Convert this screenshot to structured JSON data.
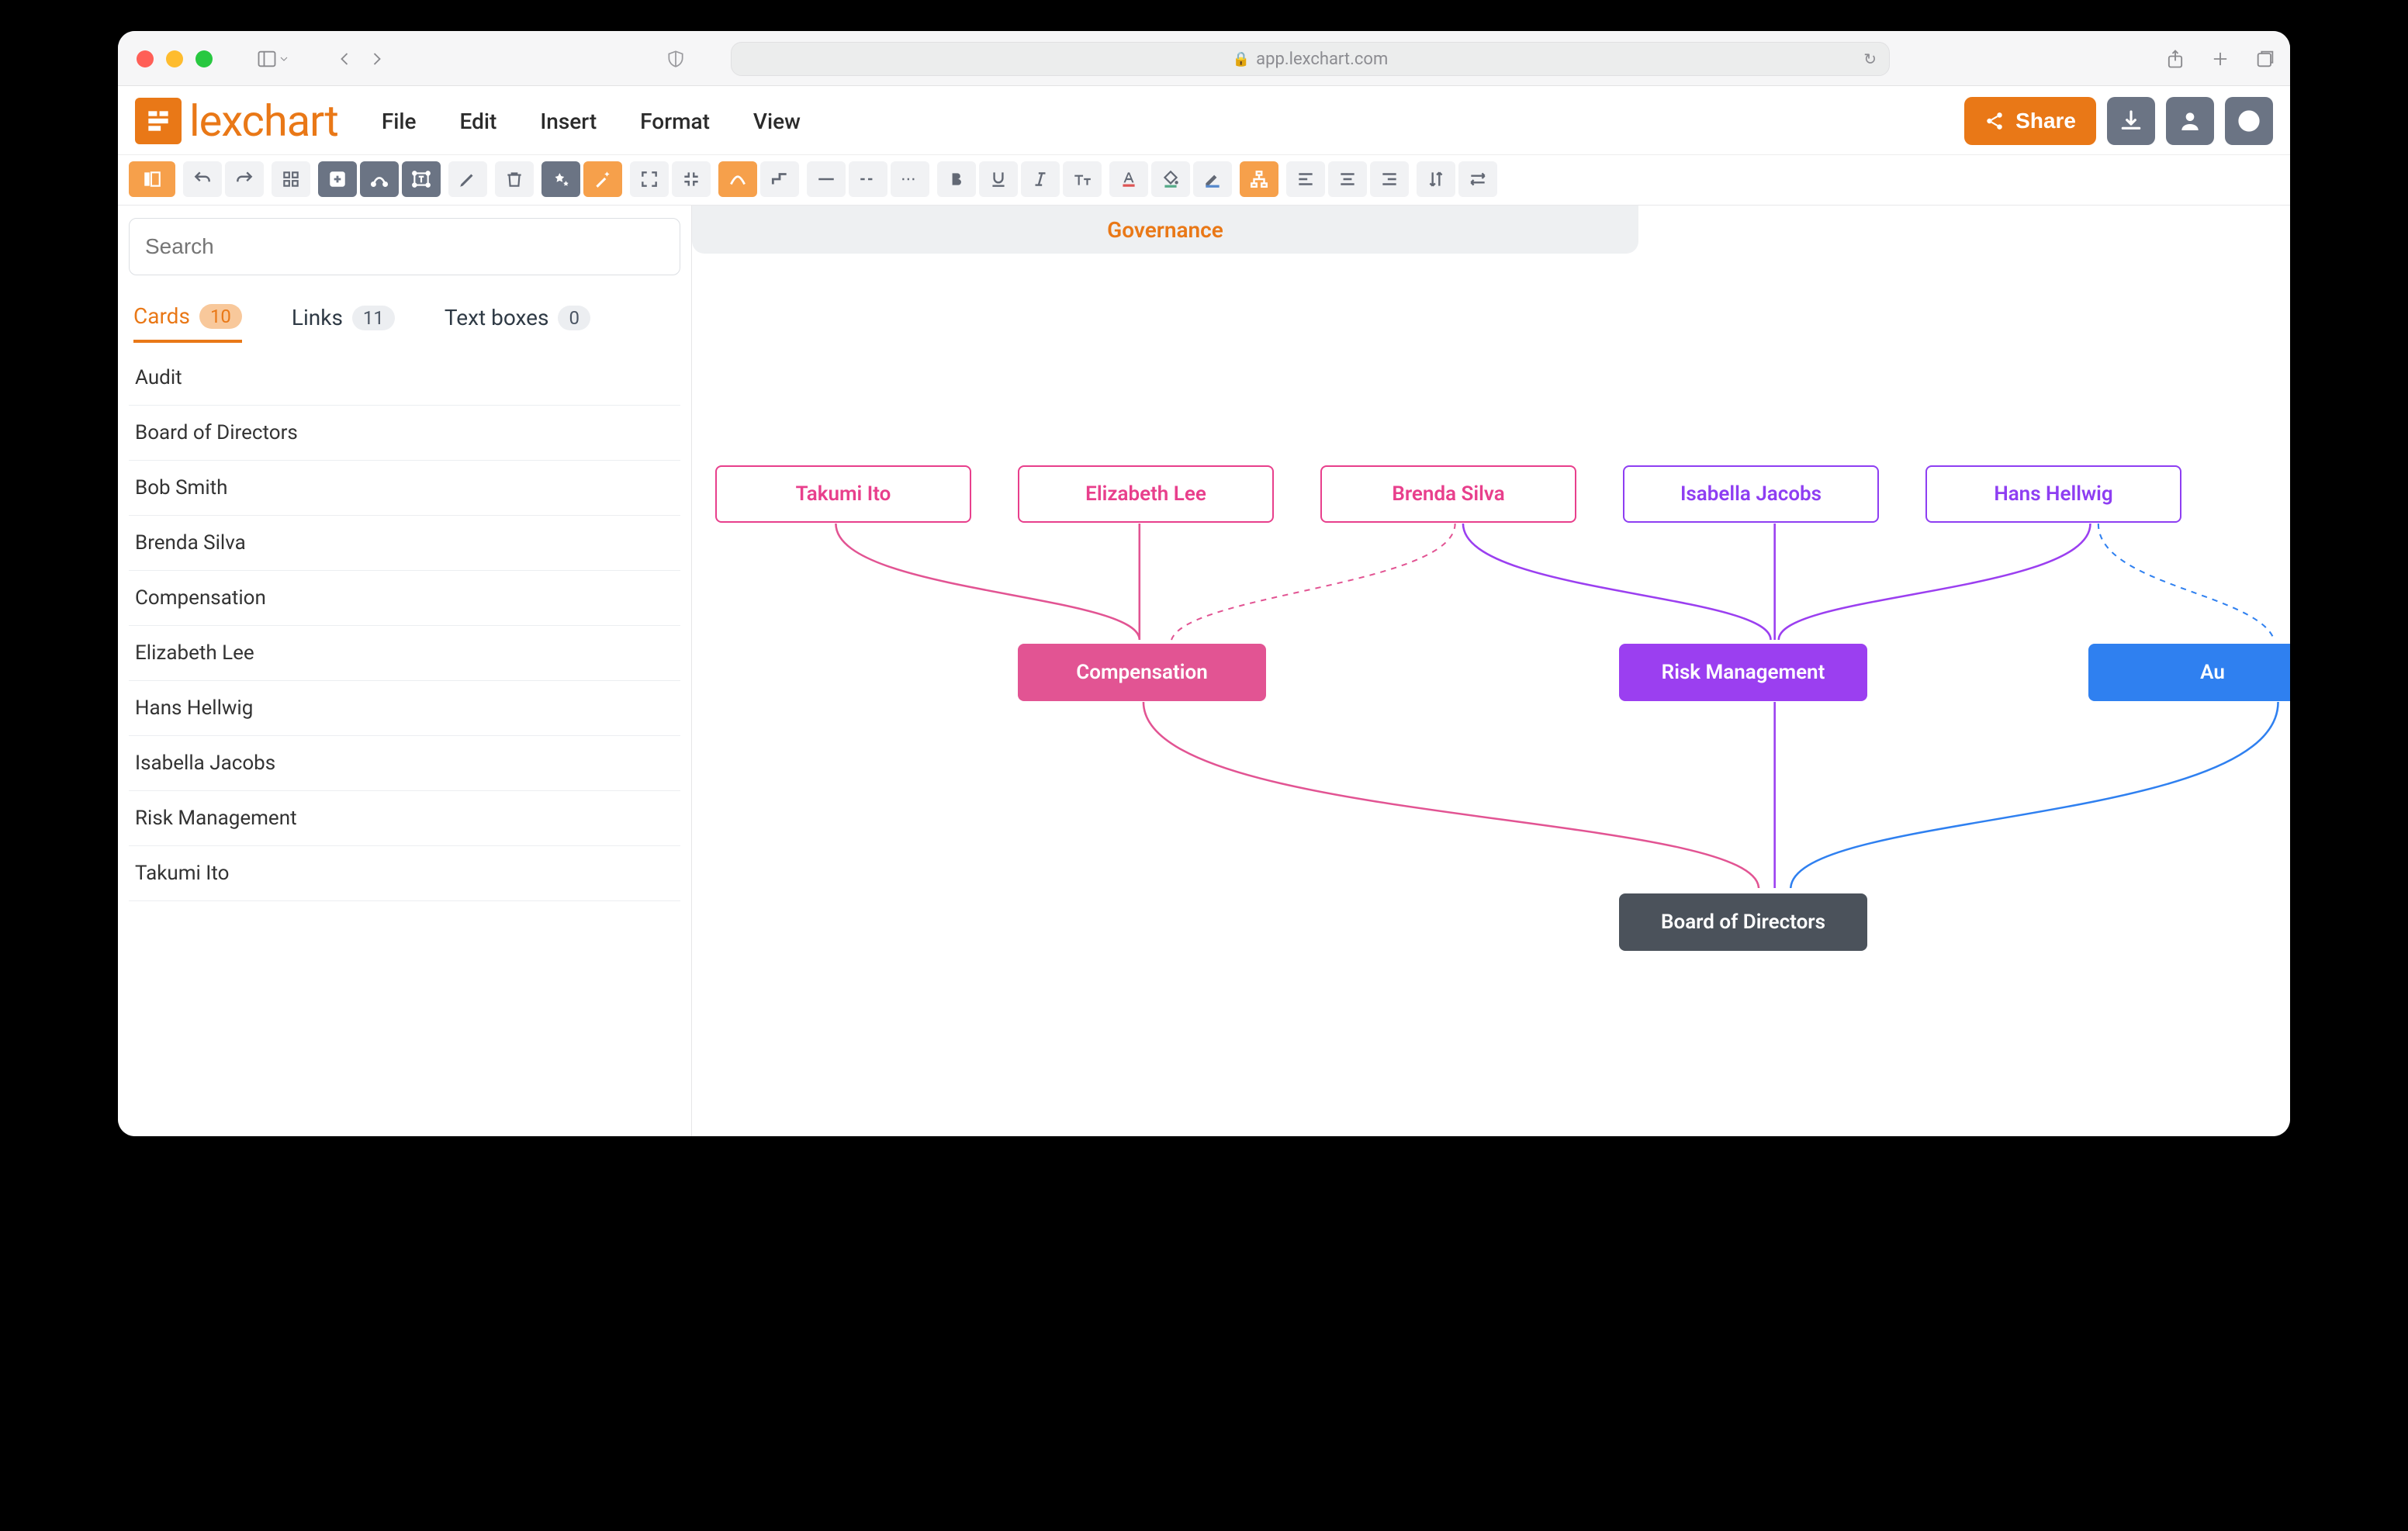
{
  "browser": {
    "url_host": "app.lexchart.com"
  },
  "app": {
    "brand": "lexchart",
    "menus": {
      "file": "File",
      "edit": "Edit",
      "insert": "Insert",
      "format": "Format",
      "view": "View"
    },
    "share": "Share"
  },
  "sidebar": {
    "search_placeholder": "Search",
    "tabs": {
      "cards": {
        "label": "Cards",
        "count": "10"
      },
      "links": {
        "label": "Links",
        "count": "11"
      },
      "textboxes": {
        "label": "Text boxes",
        "count": "0"
      }
    },
    "items": [
      "Audit",
      "Board of Directors",
      "Bob Smith",
      "Brenda Silva",
      "Compensation",
      "Elizabeth Lee",
      "Hans Hellwig",
      "Isabella Jacobs",
      "Risk Management",
      "Takumi Ito"
    ]
  },
  "document": {
    "title": "Governance"
  },
  "nodes": {
    "person1": "Takumi Ito",
    "person2": "Elizabeth Lee",
    "person3": "Brenda Silva",
    "person4": "Isabella Jacobs",
    "person5": "Hans Hellwig",
    "comp": "Compensation",
    "risk": "Risk Management",
    "audit": "Au",
    "board": "Board of Directors"
  },
  "colors": {
    "brand": "#e97817",
    "pink": "#e25493",
    "purple": "#9b3ff0",
    "blue": "#2f80f0",
    "dark": "#4b525b"
  },
  "chart_data": {
    "type": "org-tree",
    "title": "Governance",
    "nodes": [
      {
        "id": "takumi",
        "label": "Takumi Ito",
        "kind": "person",
        "color": "pink"
      },
      {
        "id": "elizabeth",
        "label": "Elizabeth Lee",
        "kind": "person",
        "color": "pink"
      },
      {
        "id": "brenda",
        "label": "Brenda Silva",
        "kind": "person",
        "color": "pink"
      },
      {
        "id": "isabella",
        "label": "Isabella Jacobs",
        "kind": "person",
        "color": "purple"
      },
      {
        "id": "hans",
        "label": "Hans Hellwig",
        "kind": "person",
        "color": "purple"
      },
      {
        "id": "comp",
        "label": "Compensation",
        "kind": "committee",
        "color": "pink"
      },
      {
        "id": "risk",
        "label": "Risk Management",
        "kind": "committee",
        "color": "purple"
      },
      {
        "id": "audit",
        "label": "Audit",
        "kind": "committee",
        "color": "blue"
      },
      {
        "id": "board",
        "label": "Board of Directors",
        "kind": "board",
        "color": "dark"
      }
    ],
    "edges": [
      {
        "from": "takumi",
        "to": "comp",
        "style": "solid"
      },
      {
        "from": "elizabeth",
        "to": "comp",
        "style": "solid"
      },
      {
        "from": "brenda",
        "to": "comp",
        "style": "dashed"
      },
      {
        "from": "brenda",
        "to": "risk",
        "style": "solid"
      },
      {
        "from": "isabella",
        "to": "risk",
        "style": "solid"
      },
      {
        "from": "hans",
        "to": "risk",
        "style": "solid"
      },
      {
        "from": "hans",
        "to": "audit",
        "style": "dashed"
      },
      {
        "from": "comp",
        "to": "board",
        "style": "solid"
      },
      {
        "from": "risk",
        "to": "board",
        "style": "solid"
      },
      {
        "from": "audit",
        "to": "board",
        "style": "solid"
      }
    ]
  }
}
